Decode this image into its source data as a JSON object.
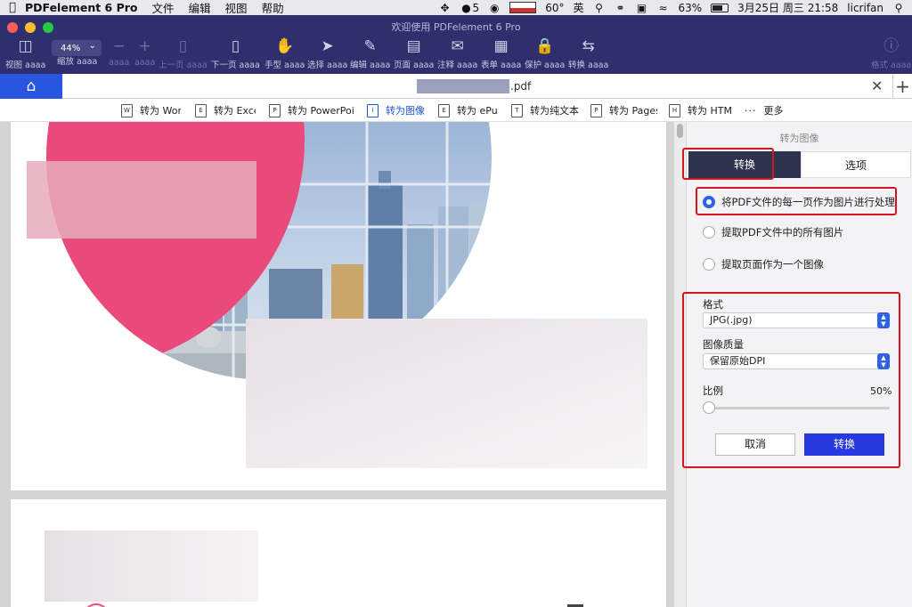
{
  "menubar": {
    "app_name": "PDFelement 6 Pro",
    "menus": [
      "文件",
      "编辑",
      "视图",
      "帮助"
    ],
    "status": {
      "qq_count": "5",
      "temperature": "60°",
      "input_method": "英",
      "battery": "63%",
      "datetime": "3月25日 周三  21:58",
      "user": "licrifan"
    }
  },
  "window": {
    "title": "欢迎使用 PDFelement 6 Pro"
  },
  "toolbar": {
    "zoom": "44%",
    "items": [
      {
        "label": "视图 aaaa"
      },
      {
        "label": "缩放 aaaa"
      },
      {
        "label": "aaaa"
      },
      {
        "label": "aaaa"
      },
      {
        "label": "上一页 aaaa"
      },
      {
        "label": "下一页 aaaa"
      },
      {
        "label": "手型 aaaa"
      },
      {
        "label": "选择 aaaa"
      },
      {
        "label": "编辑 aaaa"
      },
      {
        "label": "页面 aaaa"
      },
      {
        "label": "注释 aaaa"
      },
      {
        "label": "表单 aaaa"
      },
      {
        "label": "保护 aaaa"
      },
      {
        "label": "转换 aaaa"
      },
      {
        "label": "格式 aaaa"
      }
    ]
  },
  "tabs": {
    "document_ext": ".pdf"
  },
  "convert_bar": {
    "items": [
      {
        "label": "转为 Word",
        "icon": "W"
      },
      {
        "label": "转为 Excel",
        "icon": "E"
      },
      {
        "label": "转为 PowerPoint",
        "icon": "P"
      },
      {
        "label": "转为图像",
        "icon": "I"
      },
      {
        "label": "转为 ePub",
        "icon": "E"
      },
      {
        "label": "转为纯文本",
        "icon": "T"
      },
      {
        "label": "转为 Pages",
        "icon": "P"
      },
      {
        "label": "转为 HTML",
        "icon": "H"
      }
    ],
    "more": "更多"
  },
  "panel": {
    "title": "转为图像",
    "tabs": {
      "convert": "转换",
      "options": "选项"
    },
    "modes": [
      "将PDF文件的每一页作为图片进行处理",
      "提取PDF文件中的所有图片",
      "提取页面作为一个图像"
    ],
    "format_label": "格式",
    "format_value": "JPG(.jpg)",
    "quality_label": "图像质量",
    "quality_value": "保留原始DPI",
    "ratio_label": "比例",
    "ratio_value": "50%",
    "ratio_level": 0,
    "cancel": "取消",
    "convert": "转换"
  },
  "colors": {
    "menubar_bg": "#e9e8ec",
    "toolbar_bg": "#2f2f6e",
    "accent_blue": "#2c63e6",
    "convert_button": "#2839e0",
    "segment_dark": "#2e3350",
    "highlight_red": "#d4151b",
    "brand_pink": "#e94a7b"
  }
}
